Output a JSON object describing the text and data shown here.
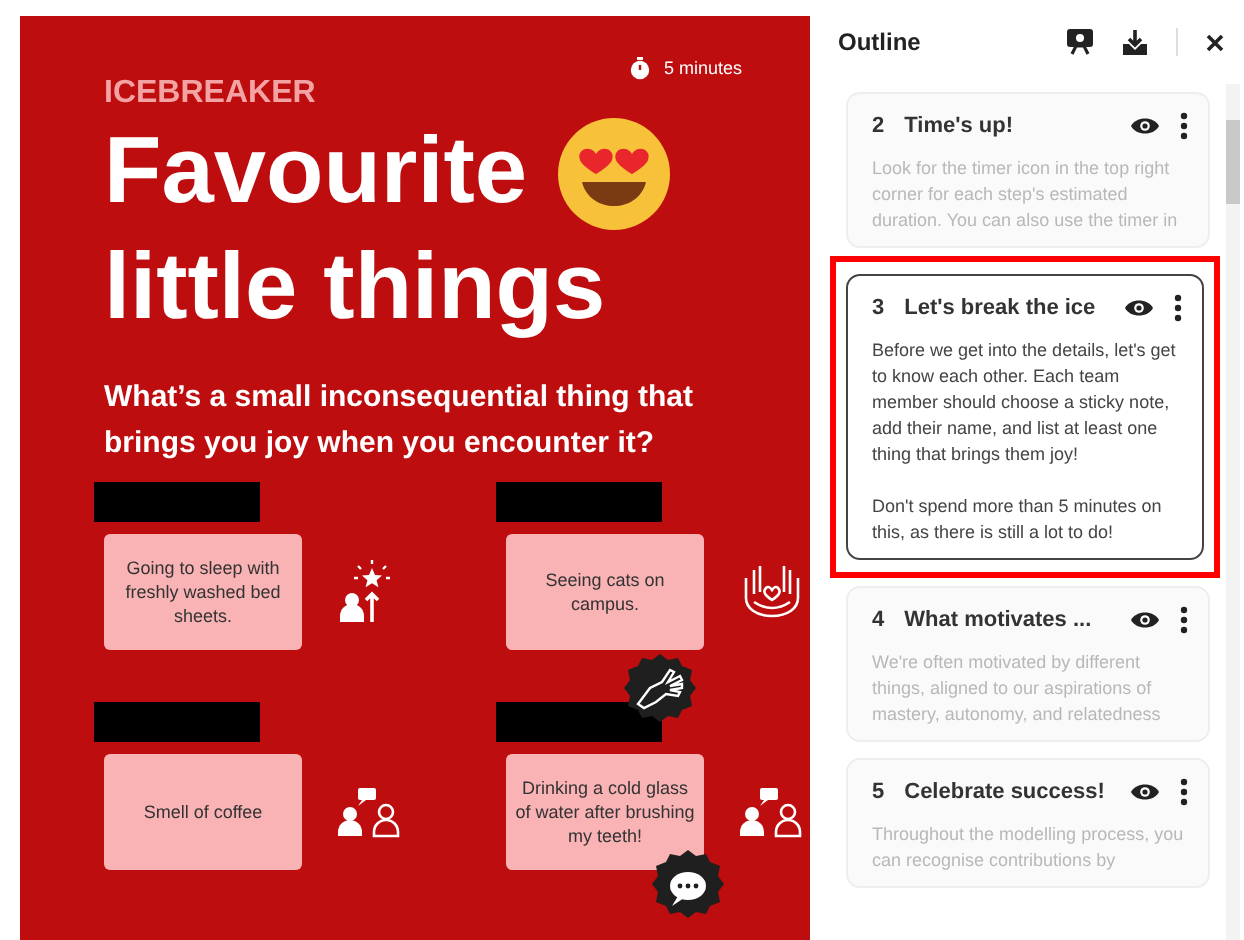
{
  "slide": {
    "category": "ICEBREAKER",
    "timer": "5 minutes",
    "title_lines": [
      "Favourite",
      "little things"
    ],
    "question": "What’s a small inconsequential thing that brings you joy when you encounter it?",
    "notes": [
      {
        "text": "Going to sleep with freshly washed bed sheets.",
        "kind": "award"
      },
      {
        "text": "Seeing cats on campus.",
        "kind": "hands"
      },
      {
        "text": "Smell of coffee",
        "kind": "conversation"
      },
      {
        "text": "Drinking a cold glass of water after brushing my teeth!",
        "kind": "conversation"
      }
    ]
  },
  "outline": {
    "title": "Outline",
    "steps": [
      {
        "number": "2",
        "title": "Time's up!",
        "selected": false,
        "body": [
          "Look for the timer icon in the top right corner for each step's estimated duration. You can also use the timer in"
        ]
      },
      {
        "number": "3",
        "title": "Let's break the ice",
        "selected": true,
        "body": [
          "Before we get into the details, let's get to know each other. Each team member should choose a sticky note, add their name, and list at least one thing that brings them joy!",
          "Don't spend more than 5 minutes on this, as there is still a lot to do!"
        ]
      },
      {
        "number": "4",
        "title": "What motivates ...",
        "selected": false,
        "body": [
          "We're often motivated by different things, aligned to our aspirations of mastery, autonomy, and relatedness"
        ]
      },
      {
        "number": "5",
        "title": "Celebrate success!",
        "selected": false,
        "body": [
          "Throughout the modelling process, you can recognise contributions by"
        ]
      }
    ]
  }
}
